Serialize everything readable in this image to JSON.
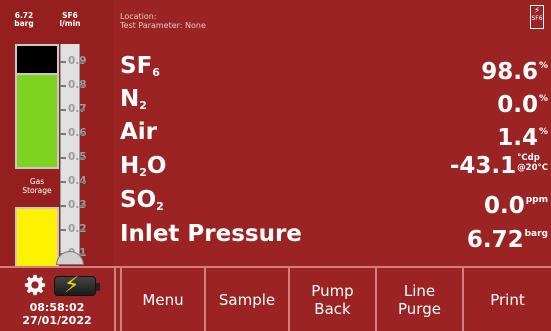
{
  "gauges": {
    "pressure_header": "6.72\nbarg",
    "flow_header": "SF6\nl/min",
    "storage_label": "Gas\nStorage",
    "ticks": [
      "0.9",
      "0.8",
      "0.7",
      "0.6",
      "0.5",
      "0.4",
      "0.3",
      "0.2",
      "0.1"
    ],
    "flow_level": 0
  },
  "header": {
    "location_label": "Location:",
    "test_parameter": "Test Parameter: None",
    "icon_text": "SF6"
  },
  "readings": [
    {
      "name": "SF",
      "sub": "6",
      "value": "98.6",
      "unit": "%"
    },
    {
      "name": "N",
      "sub": "2",
      "value": "0.0",
      "unit": "%"
    },
    {
      "name": "Air",
      "sub": "",
      "value": "1.4",
      "unit": "%"
    },
    {
      "name": "H",
      "sub": "2",
      "name_after": "O",
      "value": "-43.1",
      "unit_top": "°Cdp",
      "unit_bottom": "@20°C"
    },
    {
      "name": "SO",
      "sub": "2",
      "value": "0.0",
      "unit": "ppm"
    },
    {
      "name": "Inlet Pressure",
      "sub": "",
      "value": "6.72",
      "unit": "barg"
    }
  ],
  "status": {
    "time": "08:58:02",
    "date": "27/01/2022"
  },
  "softkeys": {
    "menu": "Menu",
    "sample": "Sample",
    "pump_back_1": "Pump",
    "pump_back_2": "Back",
    "line_purge_1": "Line",
    "line_purge_2": "Purge",
    "print": "Print"
  },
  "colors": {
    "background": "#9b2323",
    "pressure_high": "#000000",
    "pressure_ok": "#7ed321",
    "storage": "#fff200",
    "battery_bolt": "#f5d300"
  },
  "icons": {
    "settings": "gear-icon",
    "battery": "battery-charging-icon",
    "gas": "sf6-icon"
  }
}
